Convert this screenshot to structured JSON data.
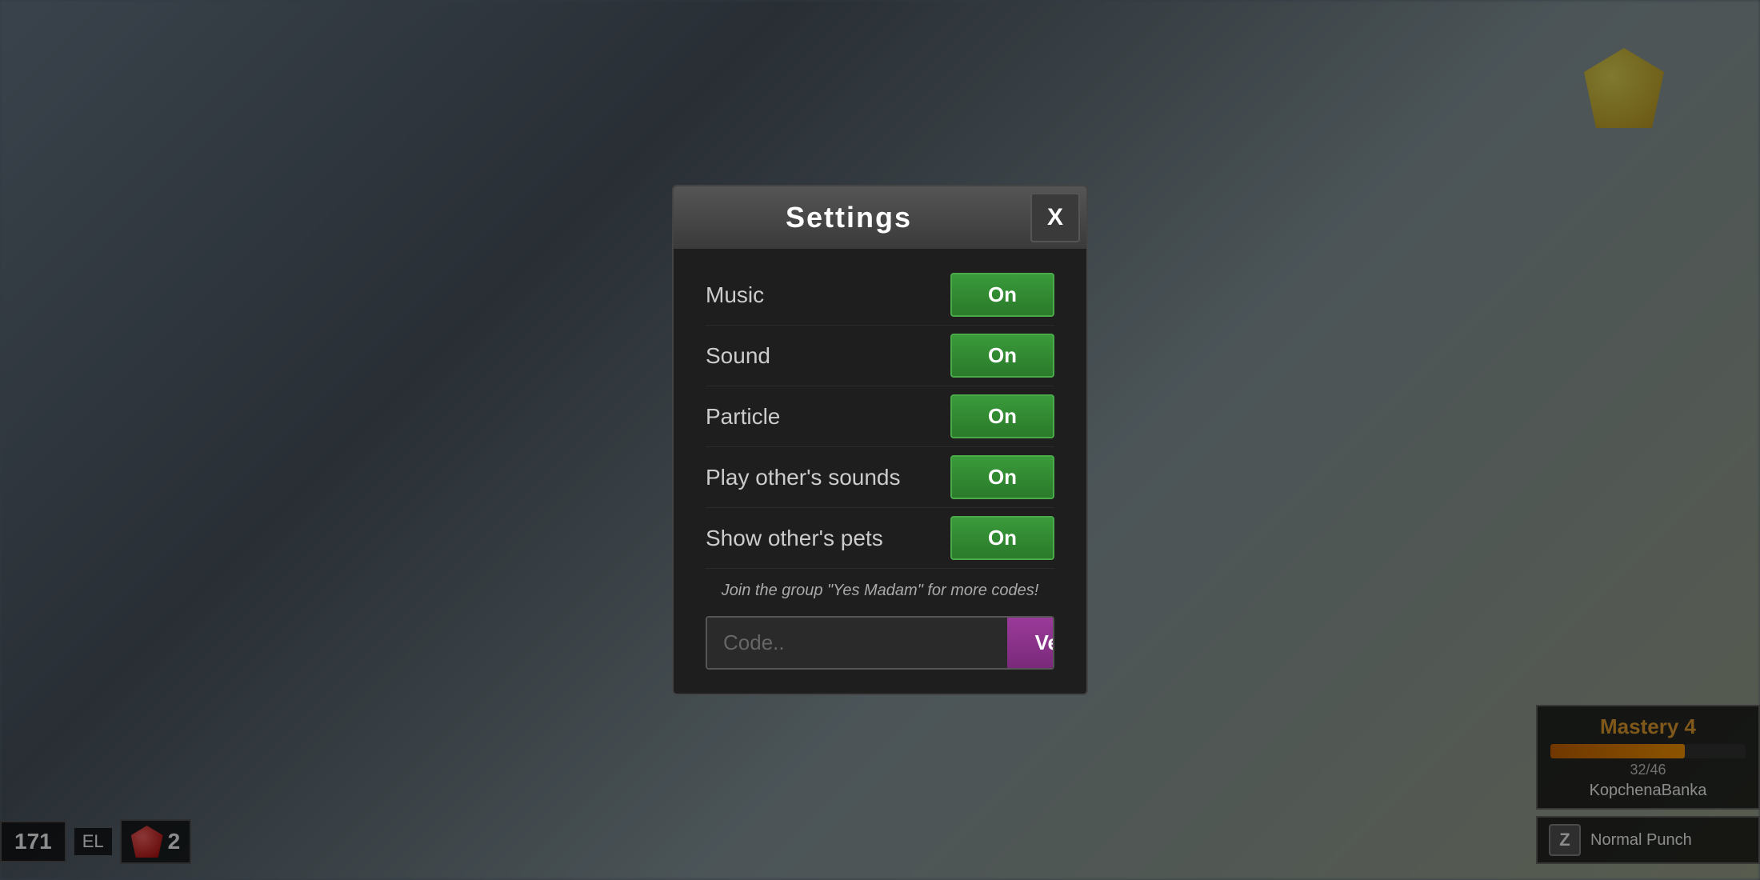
{
  "background": {
    "color": "#5a6a7a"
  },
  "modal": {
    "title": "Settings",
    "close_button_label": "X",
    "settings": [
      {
        "id": "music",
        "label": "Music",
        "value": "On"
      },
      {
        "id": "sound",
        "label": "Sound",
        "value": "On"
      },
      {
        "id": "particle",
        "label": "Particle",
        "value": "On"
      },
      {
        "id": "play-others-sounds",
        "label": "Play other's sounds",
        "value": "On"
      },
      {
        "id": "show-others-pets",
        "label": "Show other's pets",
        "value": "On"
      }
    ],
    "group_message": "Join the group \"Yes Madam\" for more codes!",
    "code_input_placeholder": "Code..",
    "verify_button_label": "Verify"
  },
  "hud": {
    "level_label": "EL",
    "level_value": "171",
    "gem_count": "2",
    "mastery_title": "Mastery 4",
    "mastery_current": "32",
    "mastery_max": "46",
    "mastery_percent": 69,
    "player_name": "KopchenaBanka",
    "skill_key": "Z",
    "skill_name": "Normal Punch"
  }
}
